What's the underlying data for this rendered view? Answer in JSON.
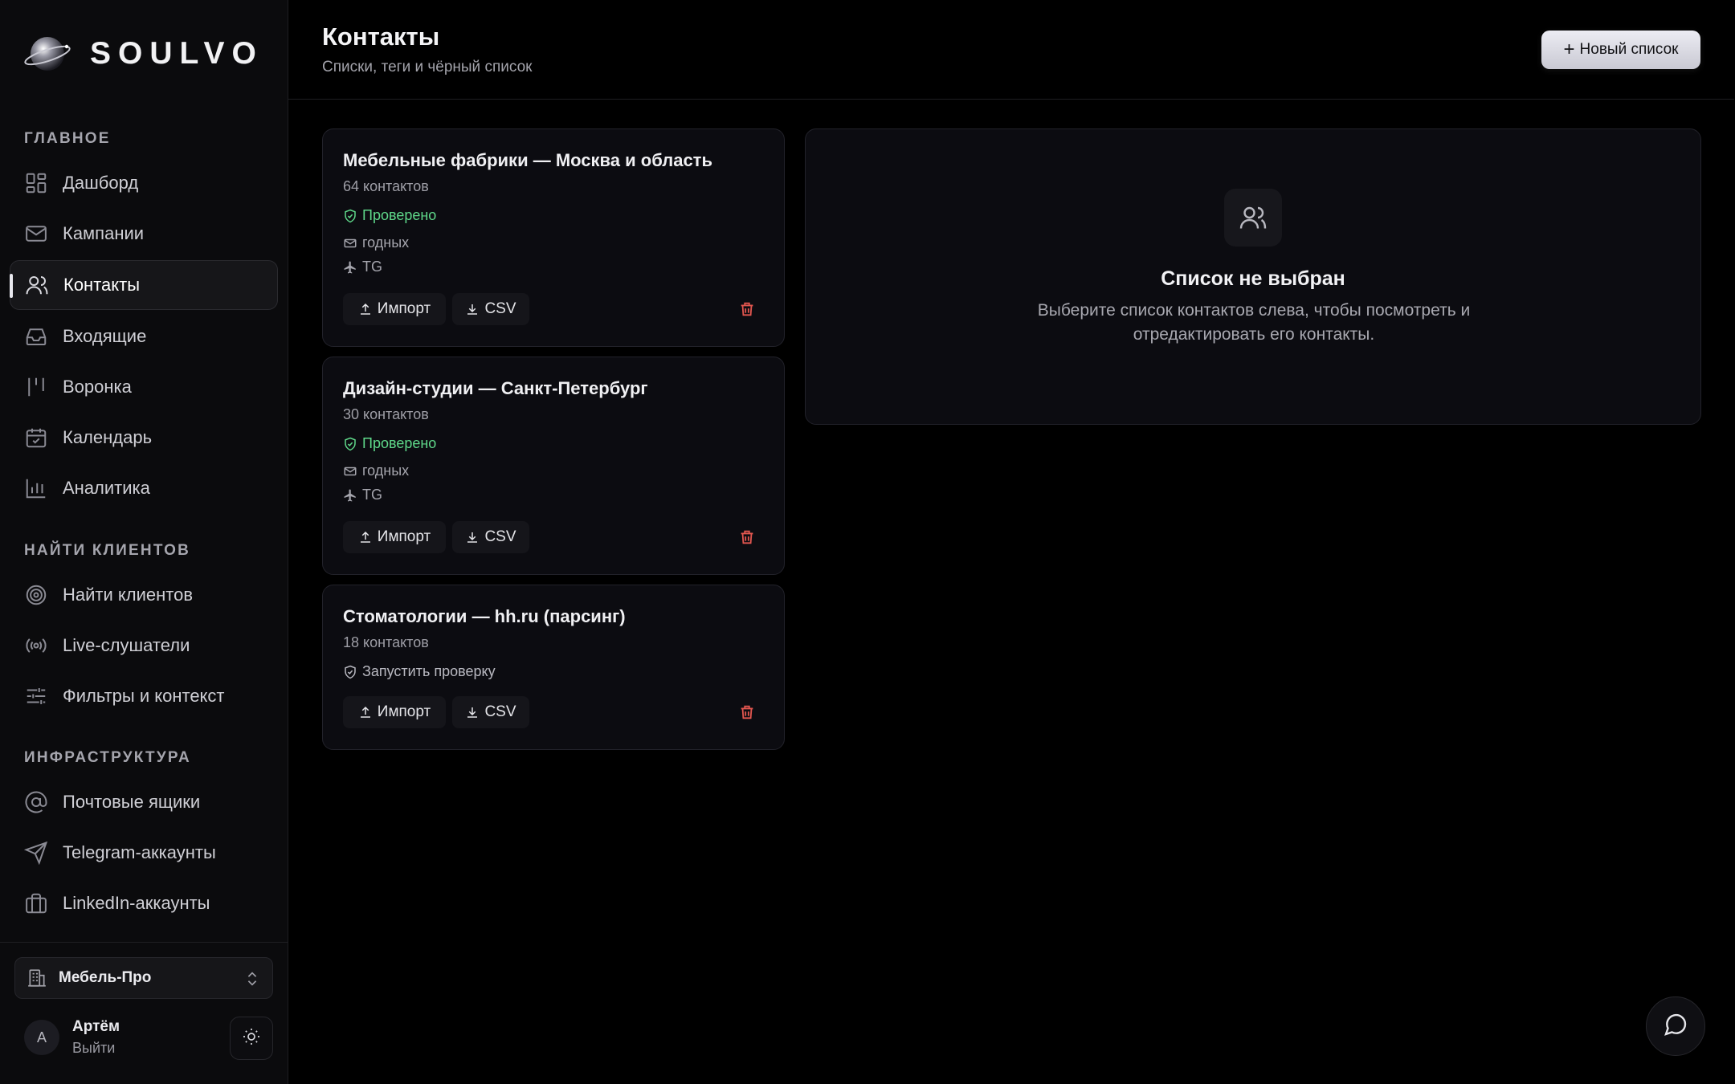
{
  "brand": {
    "name": "SOULVO"
  },
  "sidebar": {
    "sections": [
      {
        "label": "ГЛАВНОЕ",
        "items": [
          {
            "label": "Дашборд",
            "icon": "dashboard-icon"
          },
          {
            "label": "Кампании",
            "icon": "mail-icon"
          },
          {
            "label": "Контакты",
            "icon": "users-icon",
            "active": true
          },
          {
            "label": "Входящие",
            "icon": "inbox-icon"
          },
          {
            "label": "Воронка",
            "icon": "kanban-icon"
          },
          {
            "label": "Календарь",
            "icon": "calendar-icon"
          },
          {
            "label": "Аналитика",
            "icon": "bar-chart-icon"
          }
        ]
      },
      {
        "label": "НАЙТИ КЛИЕНТОВ",
        "items": [
          {
            "label": "Найти клиентов",
            "icon": "target-icon"
          },
          {
            "label": "Live-слушатели",
            "icon": "radio-icon"
          },
          {
            "label": "Фильтры и контекст",
            "icon": "sliders-icon"
          }
        ]
      },
      {
        "label": "ИНФРАСТРУКТУРА",
        "items": [
          {
            "label": "Почтовые ящики",
            "icon": "at-sign-icon"
          },
          {
            "label": "Telegram-аккаунты",
            "icon": "send-icon"
          },
          {
            "label": "LinkedIn-аккаунты",
            "icon": "briefcase-icon"
          }
        ]
      }
    ],
    "workspace": {
      "name": "Мебель-Про"
    },
    "user": {
      "initial": "А",
      "name": "Артём",
      "logout": "Выйти"
    }
  },
  "header": {
    "title": "Контакты",
    "subtitle": "Списки, теги и чёрный список",
    "new_list_label": "Новый список"
  },
  "lists": [
    {
      "title": "Мебельные фабрики — Москва и область",
      "count": "64 контактов",
      "status": "Проверено",
      "verified": true,
      "valid_label": "годных",
      "channel": "TG"
    },
    {
      "title": "Дизайн-студии — Санкт-Петербург",
      "count": "30 контактов",
      "status": "Проверено",
      "verified": true,
      "valid_label": "годных",
      "channel": "TG"
    },
    {
      "title": "Стоматологии — hh.ru (парсинг)",
      "count": "18 контактов",
      "status": "Запустить проверку",
      "verified": false
    }
  ],
  "card_actions": {
    "import_label": "Импорт",
    "csv_label": "CSV"
  },
  "empty_state": {
    "title": "Список не выбран",
    "text": "Выберите список контактов слева, чтобы посмотреть и отредактировать его контакты."
  },
  "colors": {
    "background": "#000000",
    "sidebar": "#0b0b0d",
    "card": "#0c0c11",
    "verified": "#5fd88a",
    "danger": "#e2564f"
  }
}
